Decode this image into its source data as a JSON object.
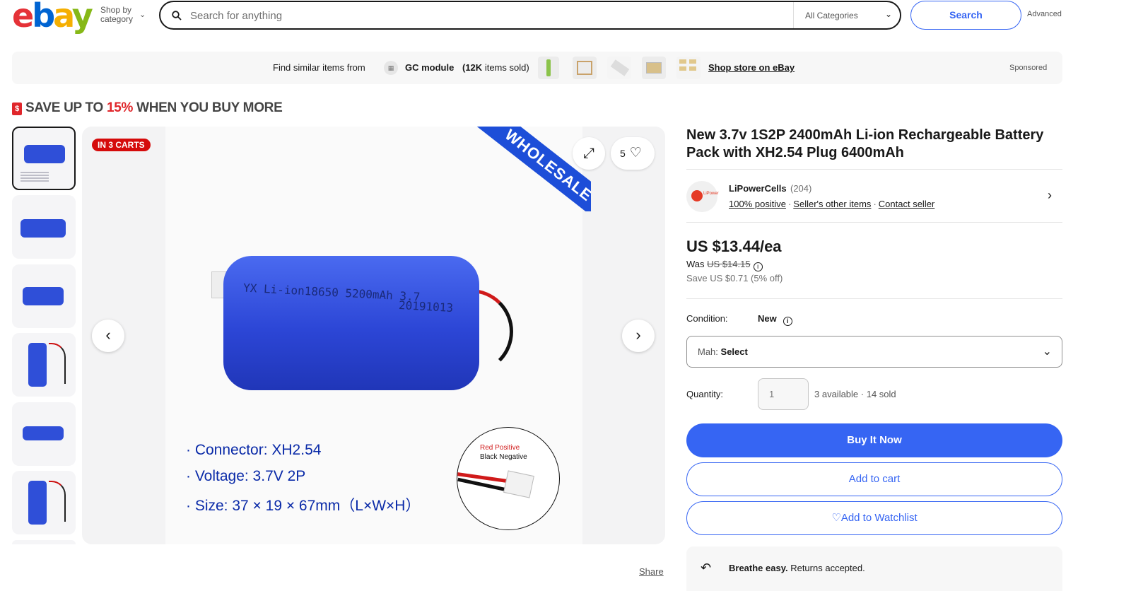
{
  "header": {
    "logo": [
      "e",
      "b",
      "a",
      "y"
    ],
    "shop_by": "Shop by",
    "shop_by_2": "category",
    "search_placeholder": "Search for anything",
    "category": "All Categories",
    "search_button": "Search",
    "advanced": "Advanced"
  },
  "banner": {
    "find_text": "Find similar items from",
    "store_name": "GC module",
    "sold_count": "(12K",
    "sold_suffix": "items sold)",
    "shop_link": "Shop store on eBay",
    "sponsored": "Sponsored"
  },
  "promo": {
    "prefix": "SAVE UP TO ",
    "percent": "15%",
    "suffix": " WHEN YOU BUY MORE"
  },
  "gallery": {
    "badge": "IN 3 CARTS",
    "ribbon": "WHOLESALE",
    "watch_count": "5",
    "battery_label": "YX Li-ion18650 5200mAh 3.7",
    "battery_date": "20191013",
    "specs": [
      "· Connector: XH2.54",
      "· Voltage: 3.7V  2P",
      "· Size: 37 × 19 × 67mm（L×W×H）"
    ],
    "inset_red": "Red Positive",
    "inset_black": "Black Negative",
    "share": "Share"
  },
  "product": {
    "title": "New 3.7v 1S2P 2400mAh Li-ion Rechargeable Battery Pack with XH2.54 Plug 6400mAh",
    "seller_name": "LiPowerCells",
    "seller_count": "(204)",
    "seller_links": [
      "100% positive",
      "Seller's other items",
      "Contact seller"
    ],
    "price": "US $13.44/ea",
    "was_label": "Was",
    "was_price": "US $14.15",
    "save": "Save US $0.71 (5% off)",
    "condition_label": "Condition:",
    "condition_value": "New",
    "mah_label": "Mah:",
    "mah_value": "Select",
    "quantity_label": "Quantity:",
    "quantity_value": "1",
    "availability": "3 available · 14 sold",
    "buy_now": "Buy It Now",
    "add_to_cart": "Add to cart",
    "add_to_watchlist": "Add to Watchlist",
    "returns_bold": "Breathe easy.",
    "returns_text": " Returns accepted."
  },
  "colors": {
    "accent": "#3665f3",
    "promo_red": "#e0262b",
    "badge_red": "#d50b0b",
    "ribbon_blue": "#1d4ed8"
  }
}
